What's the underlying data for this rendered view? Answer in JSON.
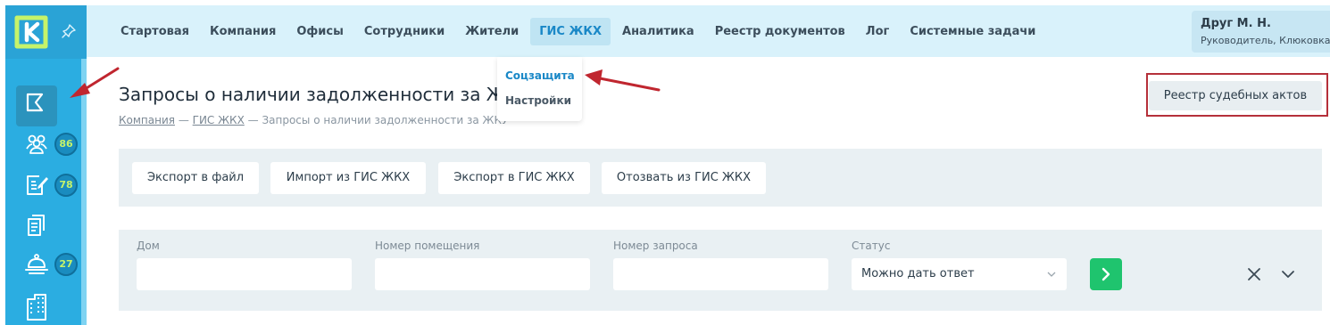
{
  "sidebar": {
    "logo": "k-logo-icon",
    "pin": "pin-icon",
    "items": [
      {
        "icon": "flag-icon",
        "active": true
      },
      {
        "icon": "people-icon",
        "badge": "86"
      },
      {
        "icon": "edit-document-icon",
        "badge": "78"
      },
      {
        "icon": "documents-icon"
      },
      {
        "icon": "service-bell-icon",
        "badge": "27"
      },
      {
        "icon": "building-icon"
      }
    ]
  },
  "nav": {
    "items": [
      "Стартовая",
      "Компания",
      "Офисы",
      "Сотрудники",
      "Жители",
      "ГИС ЖКХ",
      "Аналитика",
      "Реестр документов",
      "Лог",
      "Системные задачи"
    ],
    "active": "ГИС ЖКХ",
    "dropdown": [
      "Соцзащита",
      "Настройки"
    ]
  },
  "user": {
    "name": "Друг М. Н.",
    "role": "Руководитель, Клюковка"
  },
  "page": {
    "title": "Запросы о наличии задолженности за ЖКУ",
    "breadcrumb": {
      "company": "Компания",
      "sep": "—",
      "gis": "ГИС ЖКХ",
      "current": "Запросы о наличии задолженности за ЖКУ"
    },
    "registry_button": "Реестр судебных актов"
  },
  "toolbar": {
    "export_file": "Экспорт в файл",
    "import_gis": "Импорт из ГИС ЖКХ",
    "export_gis": "Экспорт в ГИС ЖКХ",
    "recall_gis": "Отозвать из ГИС ЖКХ"
  },
  "filters": {
    "house_label": "Дом",
    "house_value": "",
    "room_label": "Номер помещения",
    "room_value": "",
    "request_label": "Номер запроса",
    "request_value": "",
    "status_label": "Статус",
    "status_value": "Можно дать ответ"
  },
  "colors": {
    "rail": "#2bade1",
    "topbar": "#d9f2fb",
    "accent": "#1a88c7",
    "badge_text": "#c6f36a",
    "apply_button": "#1fc46e",
    "annotation": "#c0262f"
  }
}
